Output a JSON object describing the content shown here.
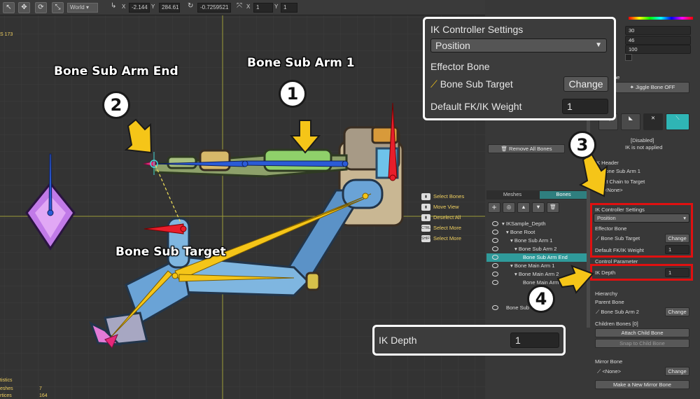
{
  "toolbar": {
    "space_select": "World",
    "x_label": "X",
    "x_value": "-2.144",
    "y_label": "Y",
    "y_value": "284.61",
    "rotation_value": "-0.7259521",
    "scale_x_label": "X",
    "scale_x_value": "1",
    "scale_y_label": "Y",
    "scale_y_value": "1"
  },
  "viewport": {
    "fps": "S 173",
    "labels": {
      "bone_sub_arm_end": "Bone Sub Arm End",
      "bone_sub_arm_1": "Bone Sub Arm 1",
      "bone_sub_target": "Bone Sub Target"
    },
    "markers": {
      "m1": "1",
      "m2": "2",
      "m3": "3",
      "m4": "4"
    },
    "hints": [
      {
        "key": "",
        "label": "Select Bones"
      },
      {
        "key": "",
        "label": "Move View"
      },
      {
        "key": "",
        "label": "Deselect All"
      },
      {
        "key": "CTRL",
        "label": "Select More"
      },
      {
        "key": "SHIFT",
        "label": "Select More"
      }
    ],
    "stats": {
      "title": "tistics",
      "meshes_label": "eshes",
      "meshes_value": "7",
      "vertices_label": "rtices",
      "vertices_value": "164"
    }
  },
  "popup_ik": {
    "title": "IK Controller Settings",
    "mode": "Position",
    "effector_label": "Effector Bone",
    "effector_value": "Bone Sub Target",
    "change_button": "Change",
    "weight_label": "Default FK/IK Weight",
    "weight_value": "1"
  },
  "popup_depth": {
    "label": "IK Depth",
    "value": "1"
  },
  "right": {
    "color_values": [
      "30",
      "46",
      "100"
    ],
    "jiggle_label": "ne",
    "jiggle_button": "Jiggle Bone OFF",
    "ik_status_line1": "[Disabled]",
    "ik_status_line2": "IK is not applied",
    "remove_all_bones": "Remove All Bones",
    "ik_header": "IK Header",
    "ik_header_value": "Bone Sub Arm 1",
    "next_chain_label": "Next Chain to Target",
    "next_chain_value": "<None>",
    "tabs": {
      "meshes": "Meshes",
      "bones": "Bones"
    },
    "tree": [
      {
        "label": "IKSample_Depth",
        "indent": 0
      },
      {
        "label": "Bone Root",
        "indent": 1
      },
      {
        "label": "Bone Sub Arm 1",
        "indent": 2
      },
      {
        "label": "Bone Sub Arm 2",
        "indent": 3
      },
      {
        "label": "Bone Sub Arm End",
        "indent": 4
      },
      {
        "label": "Bone Main Arm 1",
        "indent": 2
      },
      {
        "label": "Bone Main Arm 2",
        "indent": 3
      },
      {
        "label": "Bone Main Arm End",
        "indent": 4
      },
      {
        "label": "Bone Sub Target",
        "indent": 1
      }
    ],
    "ik_settings": {
      "title": "IK Controller Settings",
      "mode": "Position",
      "effector_label": "Effector Bone",
      "effector_value": "Bone Sub Target",
      "change": "Change",
      "weight_label": "Default FK/IK Weight",
      "weight_value": "1",
      "control_param": "Control Parameter",
      "depth_label": "IK Depth",
      "depth_value": "1"
    },
    "hierarchy": {
      "title": "Hierarchy",
      "parent_label": "Parent Bone",
      "parent_value": "Bone Sub Arm 2",
      "change": "Change",
      "children_label": "Children Bones [0]",
      "attach_child": "Attach Child Bone",
      "snap_child": "Snap to Child Bone",
      "mirror_label": "Mirror Bone",
      "mirror_value": "<None>",
      "mirror_change": "Change",
      "make_mirror": "Make a New Mirror Bone"
    }
  },
  "colors": {
    "accent": "#2fb5b5",
    "highlight_red": "#e01010",
    "arrow_yellow": "#f5c518"
  }
}
